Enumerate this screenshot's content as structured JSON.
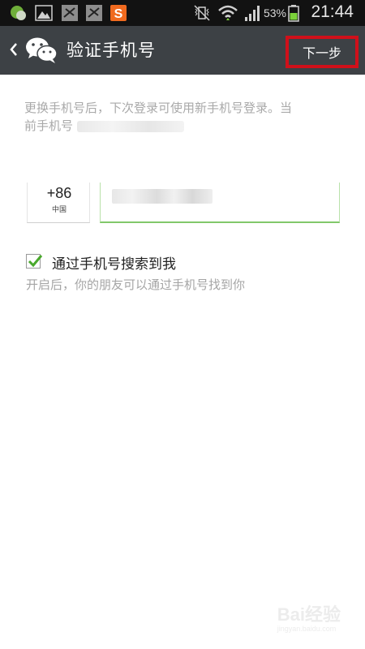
{
  "status_bar": {
    "battery_percent": "53%",
    "time": "21:44",
    "icons": [
      "wechat-notification-icon",
      "image-icon",
      "muted-app-icon",
      "muted-app-icon",
      "sogou-s-icon",
      "vibrate-mute-icon",
      "wifi-icon",
      "signal-icon",
      "battery-icon"
    ],
    "accent_battery": "#7bd13a"
  },
  "header": {
    "title": "验证手机号",
    "next_label": "下一步",
    "highlight_color": "#d0101a",
    "bar_color": "#3d4145"
  },
  "info": {
    "line1_part1": "更换手机号后，下次登录可使用新手机号登录。当",
    "line2_part1": "前手机号"
  },
  "phone": {
    "country_code": "+86",
    "country_name": "中国",
    "accent": "#82c86a"
  },
  "search_option": {
    "checked": true,
    "label": "通过手机号搜索到我",
    "description": "开启后，你的朋友可以通过手机号找到你"
  },
  "watermark": {
    "brand": "Bai",
    "suffix": "经验",
    "url": "jingyan.baidu.com"
  }
}
